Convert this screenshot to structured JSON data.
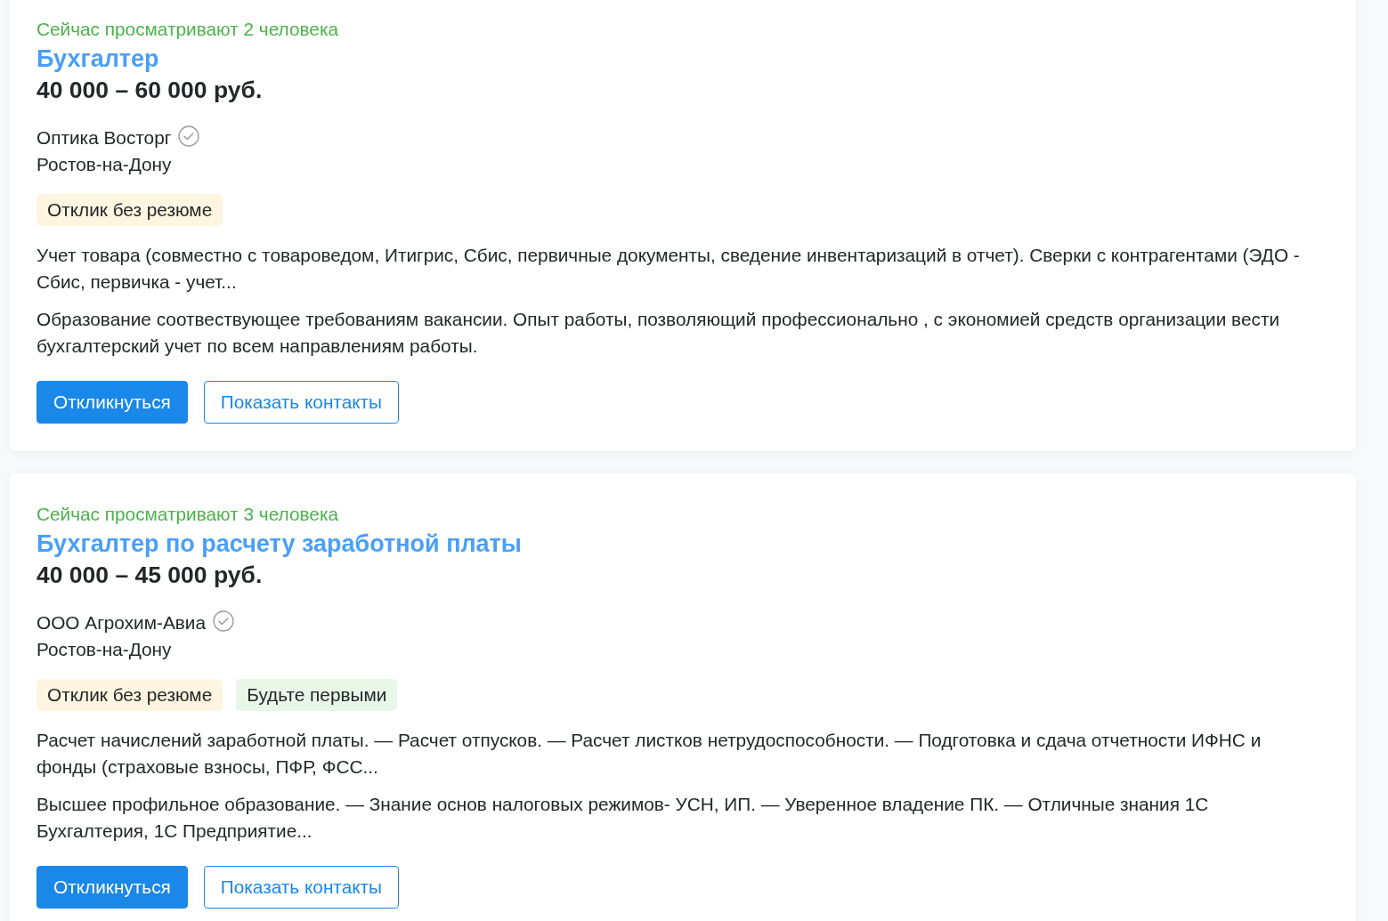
{
  "vacancies": [
    {
      "viewers": "Сейчас просматривают 2 человека",
      "title": "Бухгалтер",
      "salary": "40 000 – 60 000 руб.",
      "company": "Оптика Восторг",
      "verified": true,
      "city": "Ростов-на-Дону",
      "badges": [
        {
          "label": "Отклик без резюме",
          "color": "#fff5e0"
        }
      ],
      "snippets": [
        "Учет товара (совместно с товароведом, Итигрис, Сбис, первичные документы, сведение инвентаризаций в отчет). Сверки с контрагентами (ЭДО - Сбис, первичка - учет...",
        "Образование соотвествующее требованиям вакансии. Опыт работы, позволяющий профессионально , с экономией средств организации вести бухгалтерский учет по всем направлениям работы."
      ],
      "buttons": [
        {
          "label": "Откликнуться",
          "kind": "primary"
        },
        {
          "label": "Показать контакты",
          "kind": "outline"
        }
      ]
    },
    {
      "viewers": "Сейчас просматривают 3 человека",
      "title": "Бухгалтер по расчету заработной платы",
      "salary": "40 000 – 45 000 руб.",
      "company": "ООО Агрохим-Авиа",
      "verified": true,
      "city": "Ростов-на-Дону",
      "badges": [
        {
          "label": "Отклик без резюме",
          "color": "#fff5e0"
        },
        {
          "label": "Будьте первыми",
          "color": "#e8f7e8"
        }
      ],
      "snippets": [
        "Расчет начислений заработной платы. — Расчет отпусков. — Расчет листков нетрудоспособности. — Подготовка и сдача отчетности ИФНС и фонды (страховые взносы, ПФР, ФСС...",
        "Высшее профильное образование. — Знание основ налоговых режимов- УСН, ИП. — Уверенное владение ПК. — Отличные знания 1С Бухгалтерия, 1С Предприятие..."
      ],
      "buttons": [
        {
          "label": "Откликнуться",
          "kind": "primary"
        },
        {
          "label": "Показать контакты",
          "kind": "outline"
        }
      ]
    }
  ]
}
